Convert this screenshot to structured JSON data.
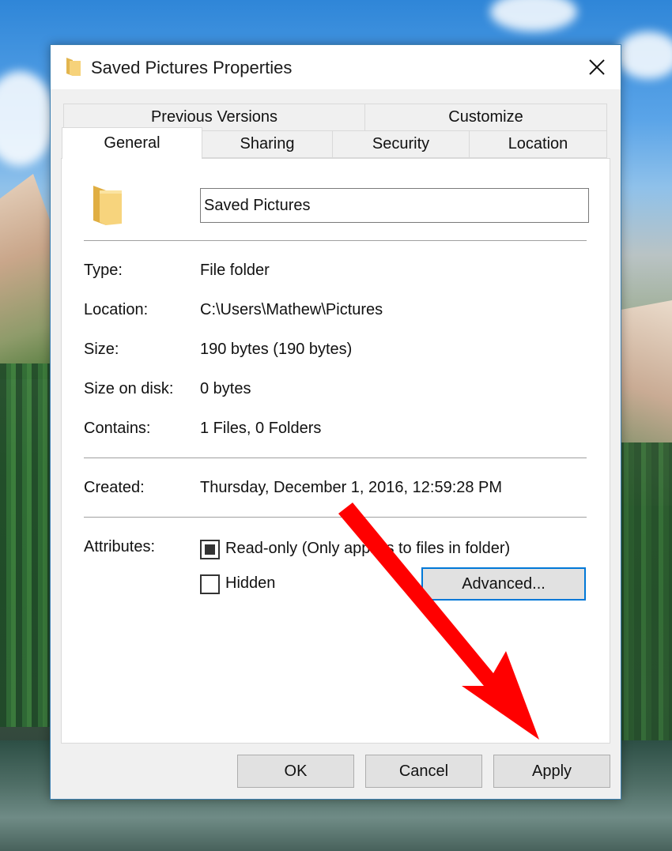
{
  "window": {
    "title": "Saved Pictures Properties"
  },
  "tabs": {
    "row1": [
      "Previous Versions",
      "Customize"
    ],
    "row2": [
      "General",
      "Sharing",
      "Security",
      "Location"
    ],
    "active": "General"
  },
  "general": {
    "folder_name": "Saved Pictures",
    "type_label": "Type:",
    "type_value": "File folder",
    "location_label": "Location:",
    "location_value": "C:\\Users\\Mathew\\Pictures",
    "size_label": "Size:",
    "size_value": "190 bytes (190 bytes)",
    "size_on_disk_label": "Size on disk:",
    "size_on_disk_value": "0 bytes",
    "contains_label": "Contains:",
    "contains_value": "1 Files, 0 Folders",
    "created_label": "Created:",
    "created_value": "Thursday, December 1, 2016, 12:59:28 PM",
    "attributes_label": "Attributes:",
    "readonly_label": "Read-only (Only applies to files in folder)",
    "readonly_state": "indeterminate",
    "hidden_label": "Hidden",
    "hidden_state": "unchecked",
    "advanced_label": "Advanced..."
  },
  "buttons": {
    "ok": "OK",
    "cancel": "Cancel",
    "apply": "Apply"
  },
  "colors": {
    "accent": "#0078d7",
    "annotation_arrow": "#ff0000"
  },
  "icons": {
    "title": "folder-icon",
    "close": "close-icon",
    "folder": "folder-icon"
  }
}
